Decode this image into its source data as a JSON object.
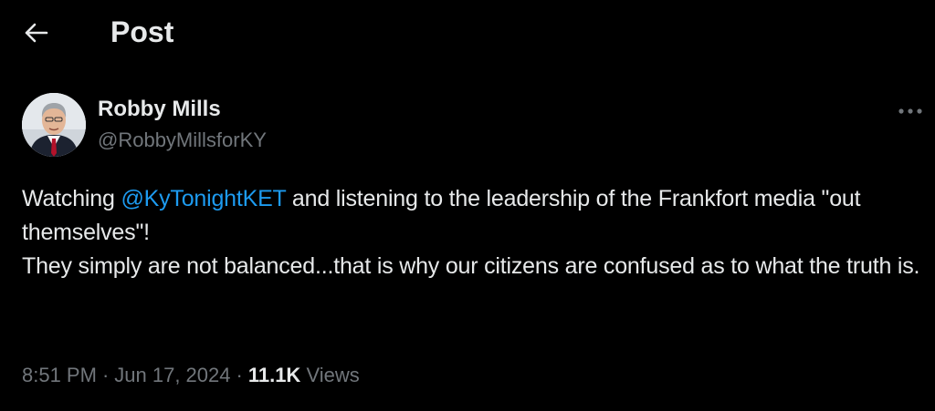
{
  "header": {
    "back_icon": "arrow-left-icon",
    "title": "Post"
  },
  "author": {
    "avatar_icon": "profile-photo",
    "display_name": "Robby Mills",
    "handle": "@RobbyMillsforKY"
  },
  "more_icon": "ellipsis-icon",
  "post": {
    "text_1": "Watching ",
    "mention": "@KyTonightKET",
    "text_2": " and listening to the leadership of the Frankfort media \"out themselves\"!\nThey simply are not balanced...that is why our citizens are confused as to what the truth is."
  },
  "meta": {
    "time": "8:51 PM",
    "separator": "·",
    "date": "Jun 17, 2024",
    "views_count": "11.1K",
    "views_label": " Views"
  },
  "colors": {
    "background": "#000000",
    "text": "#e7e9ea",
    "secondary_text": "#71767b",
    "link": "#1d9bf0"
  }
}
